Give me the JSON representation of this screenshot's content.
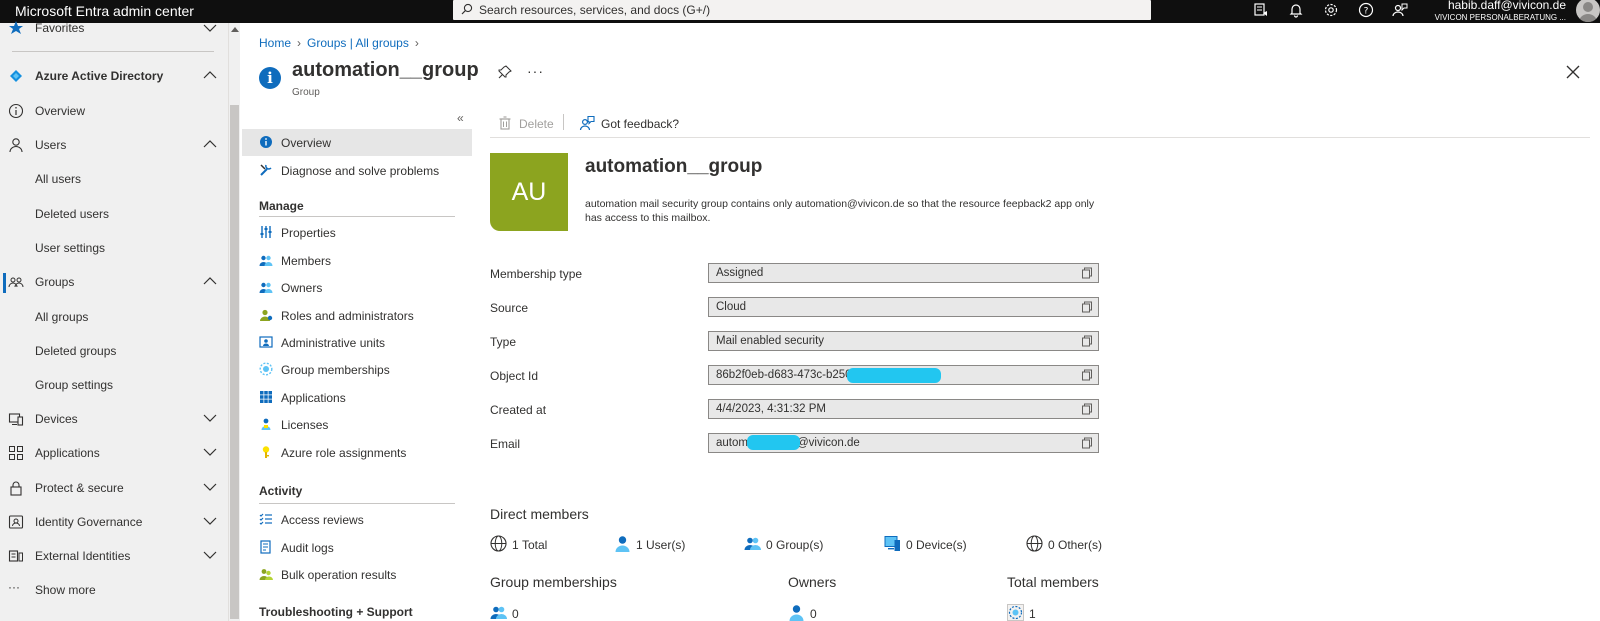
{
  "topbar": {
    "app_title": "Microsoft Entra admin center",
    "search_placeholder": "Search resources, services, and docs (G+/)",
    "user_email": "habib.daff@vivicon.de",
    "user_org": "VIVICON PERSONALBERATUNG ...",
    "icons": [
      "portal-switch-icon",
      "bell-icon",
      "gear-icon",
      "help-icon",
      "feedback-icon"
    ]
  },
  "leftnav": {
    "favorites_label": "Favorites",
    "items": [
      {
        "label": "Azure Active Directory",
        "icon": "aad-icon",
        "expanded": true
      },
      {
        "label": "Overview",
        "icon": "info-icon"
      },
      {
        "label": "Users",
        "icon": "user-icon",
        "expanded": true
      },
      {
        "label": "All users"
      },
      {
        "label": "Deleted users"
      },
      {
        "label": "User settings"
      },
      {
        "label": "Groups",
        "icon": "groups-icon",
        "expanded": true,
        "selected": true
      },
      {
        "label": "All groups"
      },
      {
        "label": "Deleted groups"
      },
      {
        "label": "Group settings"
      },
      {
        "label": "Devices",
        "icon": "devices-icon",
        "expanded": false
      },
      {
        "label": "Applications",
        "icon": "applications-icon",
        "expanded": false
      },
      {
        "label": "Protect & secure",
        "icon": "lock-icon",
        "expanded": false
      },
      {
        "label": "Identity Governance",
        "icon": "governance-icon",
        "expanded": false
      },
      {
        "label": "External Identities",
        "icon": "external-identities-icon",
        "expanded": false
      },
      {
        "label": "Show more",
        "icon": "ellipsis-icon"
      }
    ]
  },
  "breadcrumb": {
    "home": "Home",
    "groups": "Groups | All groups"
  },
  "page": {
    "title": "automation__group",
    "subtitle": "Group"
  },
  "resource_menu": {
    "overview": "Overview",
    "diagnose": "Diagnose and solve problems",
    "manage_heading": "Manage",
    "manage_items": [
      "Properties",
      "Members",
      "Owners",
      "Roles and administrators",
      "Administrative units",
      "Group memberships",
      "Applications",
      "Licenses",
      "Azure role assignments"
    ],
    "activity_heading": "Activity",
    "activity_items": [
      "Access reviews",
      "Audit logs",
      "Bulk operation results"
    ],
    "troubleshooting_heading": "Troubleshooting + Support"
  },
  "commands": {
    "delete": "Delete",
    "feedback": "Got feedback?"
  },
  "group": {
    "initials": "AU",
    "name": "automation__group",
    "description": "automation mail security group contains only automation@vivicon.de so that the resource feepback2 app only has access to this mailbox.",
    "avatar_color": "#8ca41f"
  },
  "properties": [
    {
      "label": "Membership type",
      "value": "Assigned"
    },
    {
      "label": "Source",
      "value": "Cloud"
    },
    {
      "label": "Type",
      "value": "Mail enabled security"
    },
    {
      "label": "Object Id",
      "value": "86b2f0eb-d683-473c-b250-76"
    },
    {
      "label": "Created at",
      "value": "4/4/2023, 4:31:32 PM"
    },
    {
      "label": "Email",
      "value": "automa",
      "value_suffix": "@vivicon.de"
    }
  ],
  "direct_members": {
    "title": "Direct members",
    "total_num": "1",
    "total_label": "Total",
    "users_num": "1",
    "users_label": "User(s)",
    "groups_num": "0",
    "groups_label": "Group(s)",
    "devices_num": "0",
    "devices_label": "Device(s)",
    "others_num": "0",
    "others_label": "Other(s)"
  },
  "summary": {
    "group_memberships_title": "Group memberships",
    "group_memberships_value": "0",
    "owners_title": "Owners",
    "owners_value": "0",
    "total_members_title": "Total members",
    "total_members_value": "1"
  },
  "colors": {
    "accent": "#0f6cbd",
    "redaction": "#22c6f0"
  }
}
